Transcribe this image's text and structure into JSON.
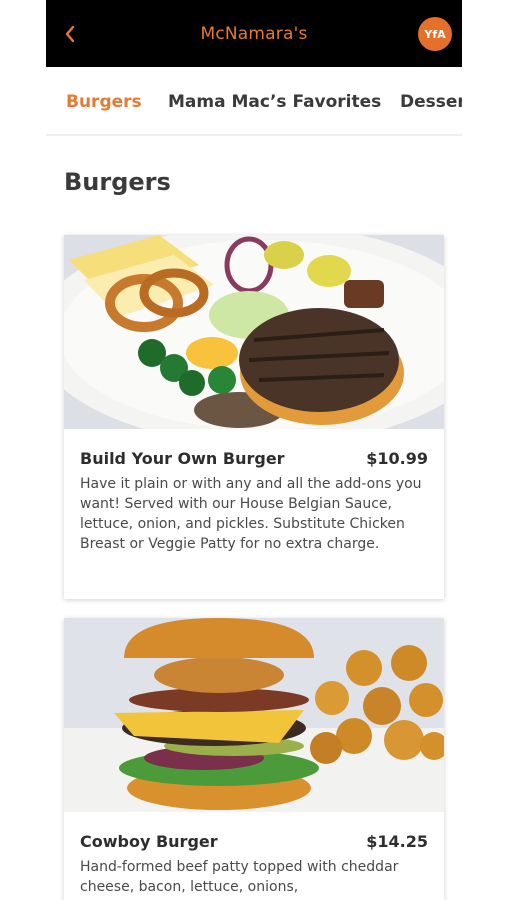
{
  "header": {
    "title": "McNamara's",
    "avatar_text": "YfA",
    "back_icon": "chevron-left-icon"
  },
  "tabs": [
    {
      "label": "Burgers",
      "active": true
    },
    {
      "label": "Mama Mac’s Favorites",
      "active": false
    },
    {
      "label": "Desser",
      "active": false
    }
  ],
  "section": {
    "title": "Burgers"
  },
  "items": [
    {
      "name": "Build Your Own Burger",
      "price": "$10.99",
      "description": "Have it plain or with any and all the add-ons you want! Served with our House Belgian Sauce, lettuce, onion, and pickles. Substitute Chicken Breast or Veggie Patty for no extra charge."
    },
    {
      "name": "Cowboy Burger",
      "price": "$14.25",
      "description": "Hand-formed beef patty topped with cheddar cheese, bacon, lettuce, onions,"
    }
  ],
  "colors": {
    "accent": "#e67a32",
    "header_bg": "#000000",
    "text_dark": "#2e2e2e"
  }
}
